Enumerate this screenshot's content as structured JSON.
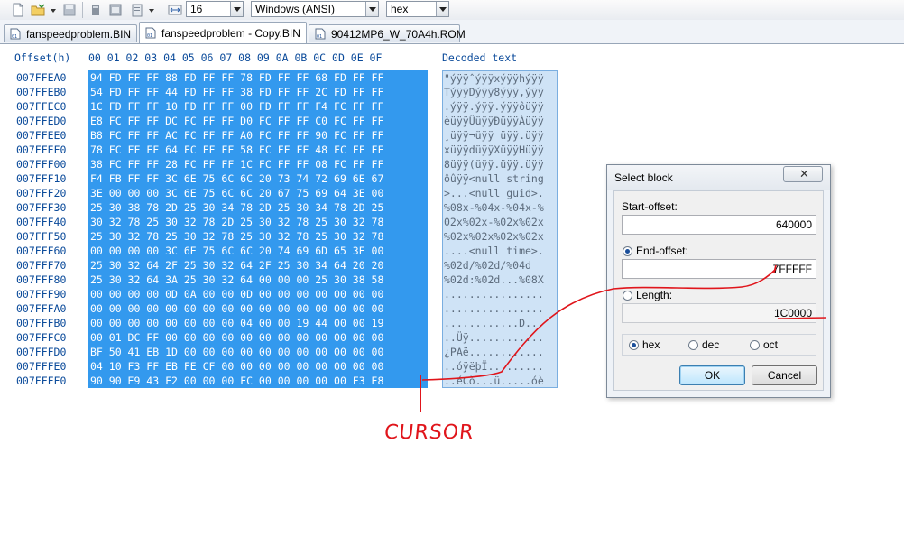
{
  "toolbar": {
    "font_size_value": "16",
    "charset_value": "Windows (ANSI)",
    "offset_base_value": "hex"
  },
  "tabs": [
    {
      "label": "fanspeedproblem.BIN",
      "active": false
    },
    {
      "label": "fanspeedproblem - Copy.BIN",
      "active": true
    },
    {
      "label": "90412MP6_W_70A4h.ROM",
      "active": false
    }
  ],
  "hex_view": {
    "offset_header": "Offset(h)",
    "column_headers": [
      "00",
      "01",
      "02",
      "03",
      "04",
      "05",
      "06",
      "07",
      "08",
      "09",
      "0A",
      "0B",
      "0C",
      "0D",
      "0E",
      "0F"
    ],
    "decoded_header": "Decoded text",
    "rows": [
      {
        "offset": "007FFEA0",
        "bytes": "94 FD FF FF 88 FD FF FF 78 FD FF FF 68 FD FF FF",
        "text": "\"ýÿÿˆýÿÿxýÿÿhýÿÿ"
      },
      {
        "offset": "007FFEB0",
        "bytes": "54 FD FF FF 44 FD FF FF 38 FD FF FF 2C FD FF FF",
        "text": "TýÿÿDýÿÿ8ýÿÿ,ýÿÿ"
      },
      {
        "offset": "007FFEC0",
        "bytes": "1C FD FF FF 10 FD FF FF 00 FD FF FF F4 FC FF FF",
        "text": ".ýÿÿ.ýÿÿ.ýÿÿôüÿÿ"
      },
      {
        "offset": "007FFED0",
        "bytes": "E8 FC FF FF DC FC FF FF D0 FC FF FF C0 FC FF FF",
        "text": "èüÿÿÜüÿÿÐüÿÿÀüÿÿ"
      },
      {
        "offset": "007FFEE0",
        "bytes": "B8 FC FF FF AC FC FF FF A0 FC FF FF 90 FC FF FF",
        "text": "¸üÿÿ¬üÿÿ üÿÿ.üÿÿ"
      },
      {
        "offset": "007FFEF0",
        "bytes": "78 FC FF FF 64 FC FF FF 58 FC FF FF 48 FC FF FF",
        "text": "xüÿÿdüÿÿXüÿÿHüÿÿ"
      },
      {
        "offset": "007FFF00",
        "bytes": "38 FC FF FF 28 FC FF FF 1C FC FF FF 08 FC FF FF",
        "text": "8üÿÿ(üÿÿ.üÿÿ.üÿÿ"
      },
      {
        "offset": "007FFF10",
        "bytes": "F4 FB FF FF 3C 6E 75 6C 6C 20 73 74 72 69 6E 67",
        "text": "ôûÿÿ<null string"
      },
      {
        "offset": "007FFF20",
        "bytes": "3E 00 00 00 3C 6E 75 6C 6C 20 67 75 69 64 3E 00",
        "text": ">...<null guid>."
      },
      {
        "offset": "007FFF30",
        "bytes": "25 30 38 78 2D 25 30 34 78 2D 25 30 34 78 2D 25",
        "text": "%08x-%04x-%04x-%"
      },
      {
        "offset": "007FFF40",
        "bytes": "30 32 78 25 30 32 78 2D 25 30 32 78 25 30 32 78",
        "text": "02x%02x-%02x%02x"
      },
      {
        "offset": "007FFF50",
        "bytes": "25 30 32 78 25 30 32 78 25 30 32 78 25 30 32 78",
        "text": "%02x%02x%02x%02x"
      },
      {
        "offset": "007FFF60",
        "bytes": "00 00 00 00 3C 6E 75 6C 6C 20 74 69 6D 65 3E 00",
        "text": "....<null time>."
      },
      {
        "offset": "007FFF70",
        "bytes": "25 30 32 64 2F 25 30 32 64 2F 25 30 34 64 20 20",
        "text": "%02d/%02d/%04d  "
      },
      {
        "offset": "007FFF80",
        "bytes": "25 30 32 64 3A 25 30 32 64 00 00 00 25 30 38 58",
        "text": "%02d:%02d...%08X"
      },
      {
        "offset": "007FFF90",
        "bytes": "00 00 00 00 0D 0A 00 00 0D 00 00 00 00 00 00 00",
        "text": "................"
      },
      {
        "offset": "007FFFA0",
        "bytes": "00 00 00 00 00 00 00 00 00 00 00 00 00 00 00 00",
        "text": "................"
      },
      {
        "offset": "007FFFB0",
        "bytes": "00 00 00 00 00 00 00 00 04 00 00 19 44 00 00 19",
        "text": "............D..."
      },
      {
        "offset": "007FFFC0",
        "bytes": "00 01 DC FF 00 00 00 00 00 00 00 00 00 00 00 00",
        "text": "..Üÿ............"
      },
      {
        "offset": "007FFFD0",
        "bytes": "BF 50 41 EB 1D 00 00 00 00 00 00 00 00 00 00 00",
        "text": "¿PAë............"
      },
      {
        "offset": "007FFFE0",
        "bytes": "04 10 F3 FF EB FE CF 00 00 00 00 00 00 00 00 00",
        "text": "..óÿëþÏ........."
      },
      {
        "offset": "007FFFF0",
        "bytes": "90 90 E9 43 F2 00 00 00 FC 00 00 00 00 00 F3 E8",
        "text": "..éCò...ü.....óè"
      }
    ]
  },
  "dialog": {
    "title": "Select block",
    "close_symbol": "✕",
    "start_offset_label": "Start-offset:",
    "start_offset_value": "640000",
    "end_offset_label": "End-offset:",
    "end_offset_value": "7FFFFF",
    "length_label": "Length:",
    "length_value": "1C0000",
    "selected_mode": "end-offset",
    "bases": [
      {
        "label": "hex",
        "selected": true
      },
      {
        "label": "dec",
        "selected": false
      },
      {
        "label": "oct",
        "selected": false
      }
    ],
    "ok_label": "OK",
    "cancel_label": "Cancel"
  },
  "annotation": {
    "cursor_label": "CURSOR",
    "color": "#e0151b"
  },
  "colors": {
    "selection": "#3399ee",
    "decoded_selection": "#cfe3f6",
    "offset_text": "#0a4a9a"
  }
}
